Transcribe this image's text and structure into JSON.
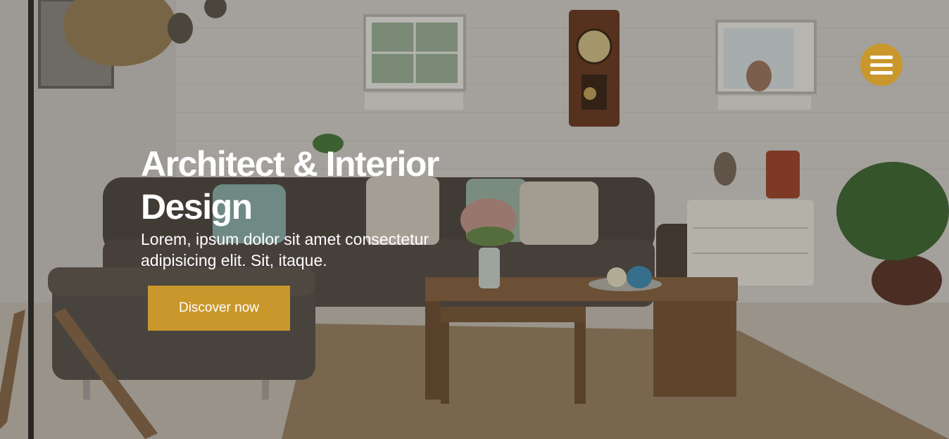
{
  "hero": {
    "title": "Architect & Interior Design",
    "subtitle": "Lorem, ipsum dolor sit amet consectetur adipisicing elit. Sit, itaque.",
    "cta_label": "Discover now",
    "background_alt": "Living room interior with grey sofa, wooden coffee table, white brick wall and vintage wall clock"
  },
  "menu": {
    "icon": "hamburger-icon"
  },
  "colors": {
    "accent": "#c9972b",
    "text": "#ffffff",
    "overlay": "rgba(30,28,26,0.28)"
  }
}
